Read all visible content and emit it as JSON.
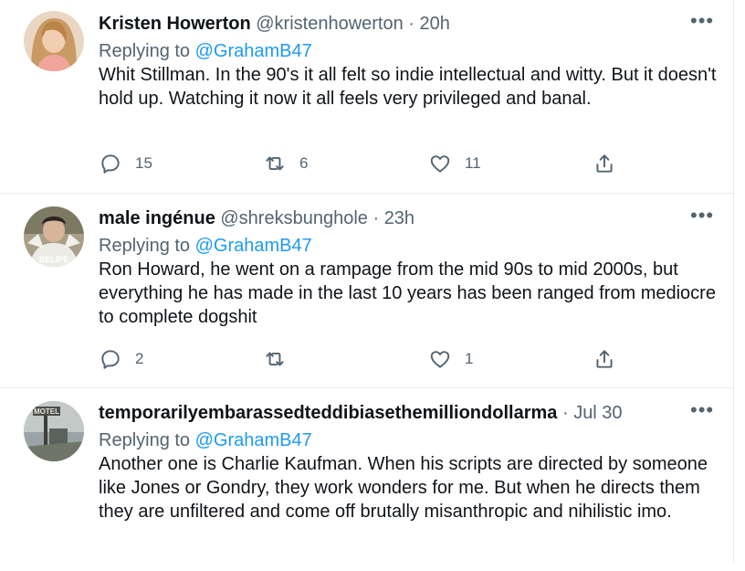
{
  "tweets": [
    {
      "name": "Kristen Howerton",
      "handle": "@kristenhowerton",
      "separator": "·",
      "time": "20h",
      "replying_prefix": "Replying to ",
      "replying_to": "@GrahamB47",
      "text": "Whit Stillman. In the 90's it all felt so indie intellectual and witty. But it doesn't hold up. Watching it now it all feels very privileged and banal.",
      "replies": "15",
      "retweets": "6",
      "likes": "11",
      "avatar_icon": "avatar-kristen"
    },
    {
      "name": "male ingénue",
      "handle": "@shreksbunghole",
      "separator": "·",
      "time": "23h",
      "replying_prefix": "Replying to ",
      "replying_to": "@GrahamB47",
      "text": "Ron Howard, he went on a rampage from the mid 90s to mid 2000s, but everything he has made in the last 10 years has been ranged from mediocre to complete dogshit",
      "replies": "2",
      "retweets": "",
      "likes": "1",
      "avatar_icon": "avatar-male-ingenue",
      "avatar_text": "BELIPE"
    },
    {
      "name": "temporarilyembarassedteddibiasethemilliondollarma",
      "handle": "",
      "separator": "·",
      "time": "Jul 30",
      "replying_prefix": "Replying to ",
      "replying_to": "@GrahamB47",
      "text": "Another one is Charlie Kaufman. When his scripts are directed by someone like Jones or Gondry, they work wonders for me. But when he directs them they are unfiltered and come off brutally misanthropic and nihilistic imo.",
      "avatar_icon": "avatar-motel-sign",
      "avatar_text": "MOTEL"
    }
  ],
  "more_glyph": "•••",
  "colors": {
    "link": "#1d9bf0",
    "muted": "#536471",
    "text": "#0f1419",
    "divider": "#e6ecf0"
  },
  "action_icons": [
    "reply-icon",
    "retweet-icon",
    "like-icon",
    "share-icon"
  ]
}
